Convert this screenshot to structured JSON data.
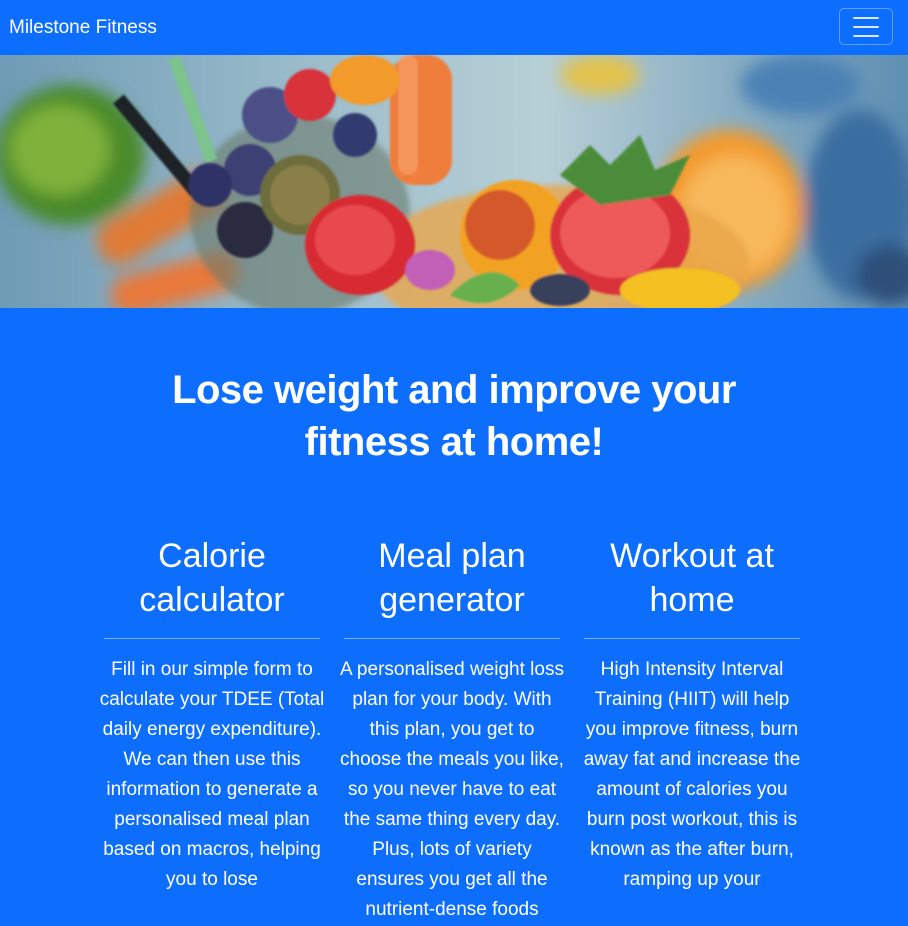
{
  "navbar": {
    "brand": "Milestone Fitness",
    "menu_icon": "hamburger-menu-icon"
  },
  "hero": {
    "image_subject": "smoothie bowl with strawberries, blueberries, chia seeds, mint, flowers, carrot, avocado and orange"
  },
  "headline": {
    "line1": "Lose weight and improve your",
    "line2": "fitness at home!"
  },
  "features": [
    {
      "title_line1": "Calorie",
      "title_line2": "calculator",
      "text": "Fill in our simple form to calculate your TDEE (Total daily energy expenditure). We can then use this information to generate a personalised meal plan based on macros, helping you to lose"
    },
    {
      "title_line1": "Meal plan",
      "title_line2": "generator",
      "text": "A personalised weight loss plan for your body. With this plan, you get to choose the meals you like, so you never have to eat the same thing every day. Plus, lots of variety ensures you get all the nutrient-dense foods"
    },
    {
      "title_line1": "Workout at",
      "title_line2": "home",
      "text": "High Intensity Interval Training (HIIT) will help you improve fitness, burn away fat and increase the amount of calories you burn post workout, this is known as the after burn, ramping up your"
    }
  ],
  "colors": {
    "primary": "#0d6efd",
    "text": "#ffffff"
  }
}
